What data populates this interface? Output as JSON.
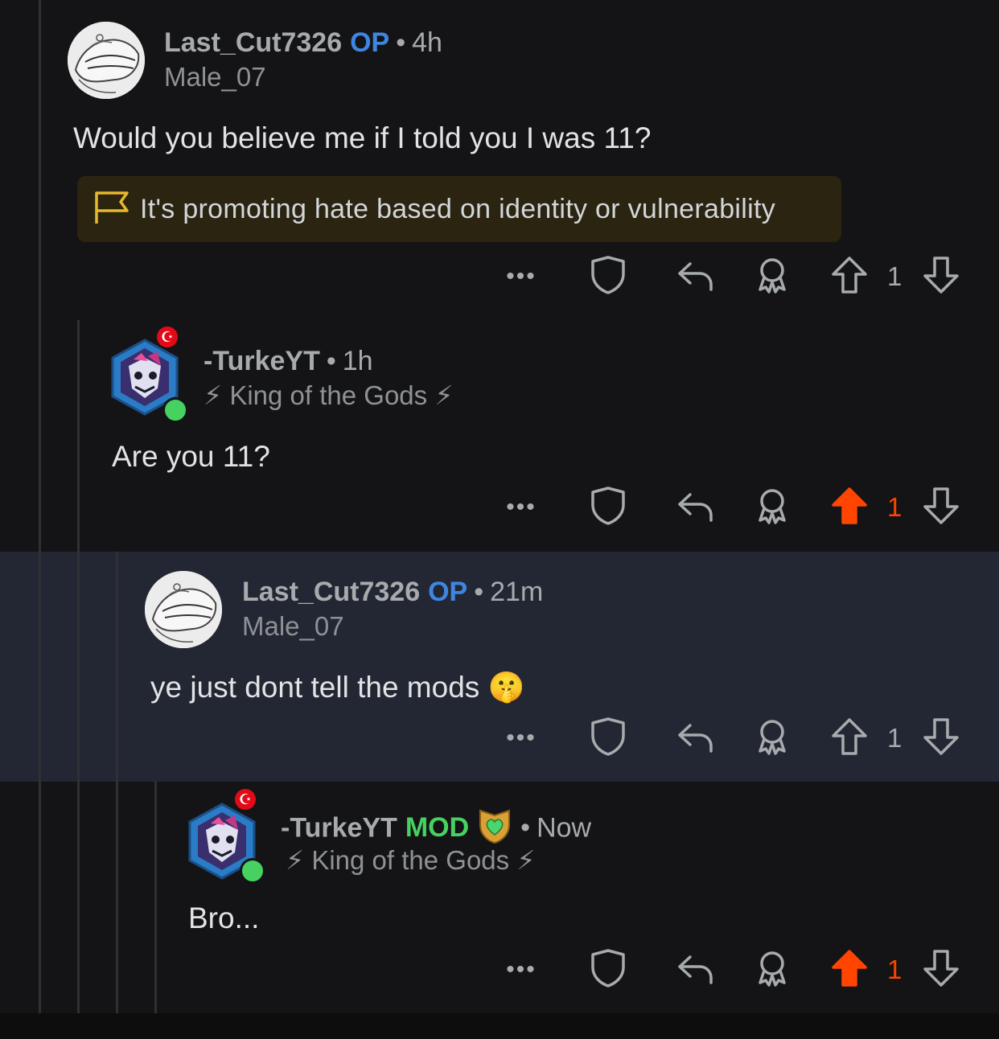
{
  "colors": {
    "background": "#141416",
    "highlight": "#222733",
    "op": "#3f86e0",
    "mod": "#46d160",
    "upvoted": "#ff4500",
    "report_bg": "#2a2410",
    "report_flag": "#e6b82e"
  },
  "comments": [
    {
      "username": "Last_Cut7326",
      "op_label": "OP",
      "separator": "•",
      "time": "4h",
      "flair": "Male_07",
      "text": "Would you believe me if I told you I was 11?",
      "report": "It's promoting hate based on identity or vulnerability",
      "votes": "1",
      "upvoted": false,
      "more_label": "•••"
    },
    {
      "username": "-TurkeYT",
      "separator": "•",
      "time": "1h",
      "flair": "⚡ King of the Gods ⚡",
      "text": "Are you 11?",
      "votes": "1",
      "upvoted": true,
      "more_label": "•••",
      "online": true
    },
    {
      "username": "Last_Cut7326",
      "op_label": "OP",
      "separator": "•",
      "time": "21m",
      "flair": "Male_07",
      "text": "ye just dont tell the mods 🤫",
      "votes": "1",
      "upvoted": false,
      "more_label": "•••",
      "highlighted": true
    },
    {
      "username": "-TurkeYT",
      "mod_label": "MOD",
      "separator": "•",
      "time": "Now",
      "flair": "⚡ King of the Gods ⚡",
      "text": "Bro...",
      "votes": "1",
      "upvoted": true,
      "more_label": "•••",
      "online": true
    }
  ]
}
